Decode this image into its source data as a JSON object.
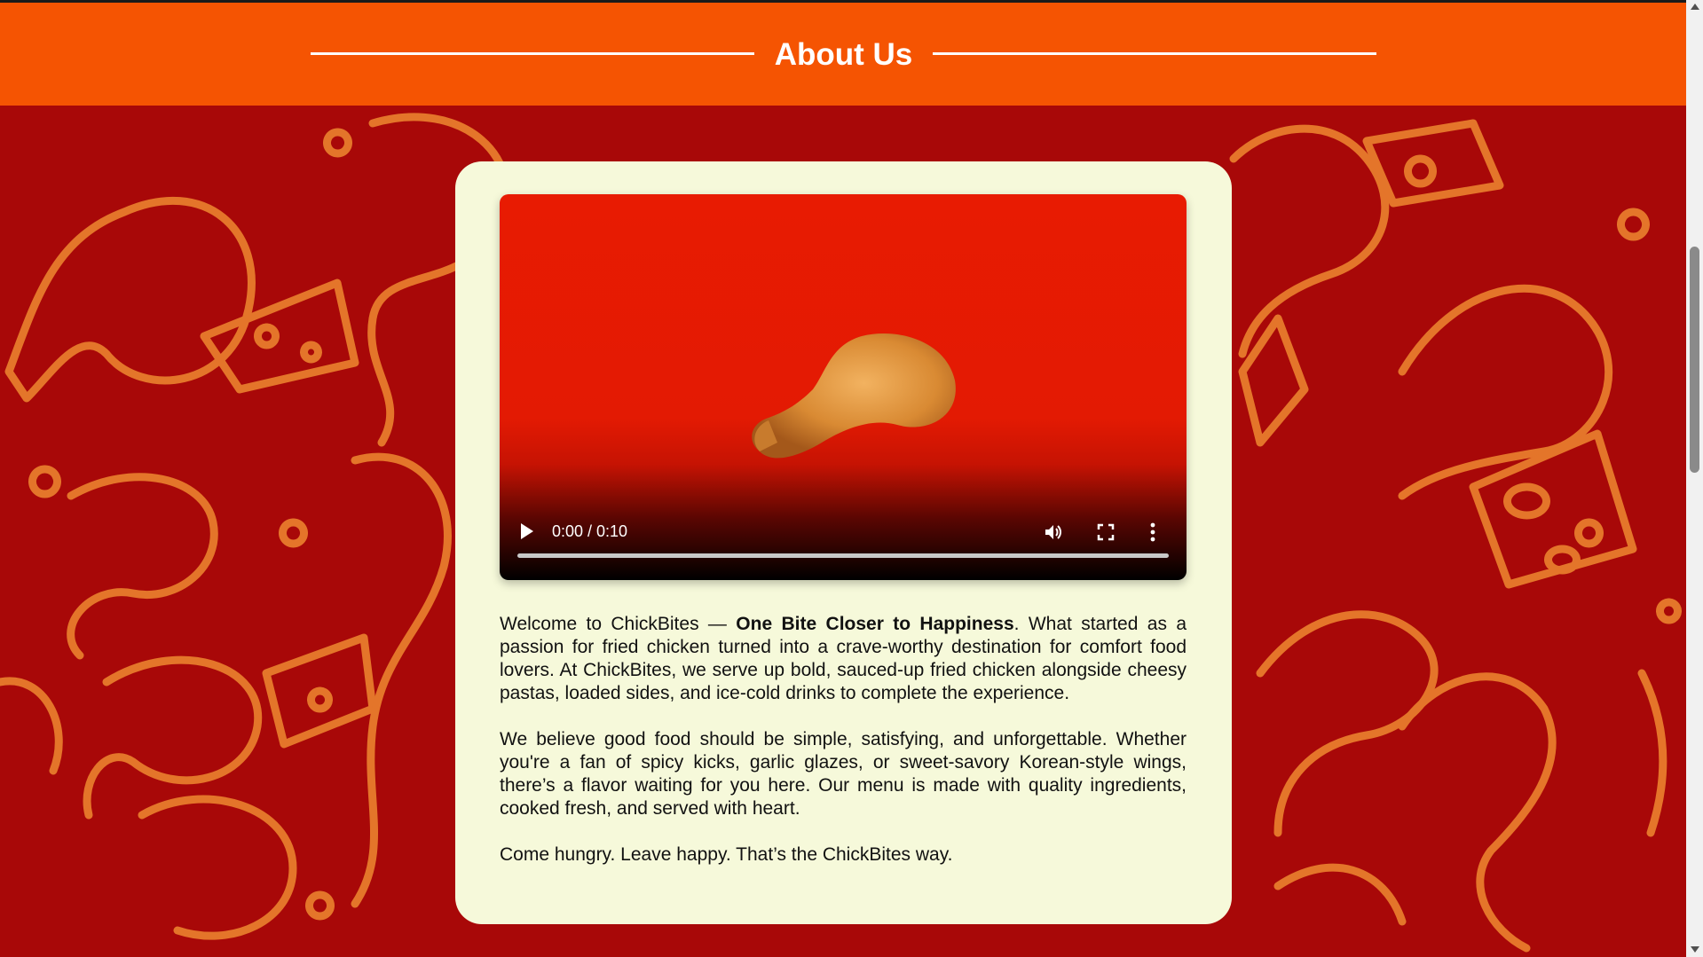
{
  "header": {
    "title": "About Us"
  },
  "video": {
    "time": "0:00 / 0:10",
    "progress": 0
  },
  "about": {
    "p1_prefix": "Welcome to ChickBites — ",
    "p1_bold": "One Bite Closer to Happiness",
    "p1_rest": ". What started as a passion for fried chicken turned into a crave-worthy destination for comfort food lovers. At ChickBites, we serve up bold, sauced-up fried chicken alongside cheesy pastas, loaded sides, and ice-cold drinks to complete the experience.",
    "p2": "We believe good food should be simple, satisfying, and unforgettable. Whether you're a fan of spicy kicks, garlic glazes, or sweet-savory Korean-style wings, there’s a flavor waiting for you here. Our menu is made with quality ingredients, cooked fresh, and served with heart.",
    "p3": "Come hungry. Leave happy. That’s the ChickBites way."
  },
  "colors": {
    "header_bg": "#f55402",
    "page_bg": "#a80808",
    "doodle": "#e87b2c",
    "card_bg": "#f6f9da",
    "video_bg": "#e81b02"
  }
}
